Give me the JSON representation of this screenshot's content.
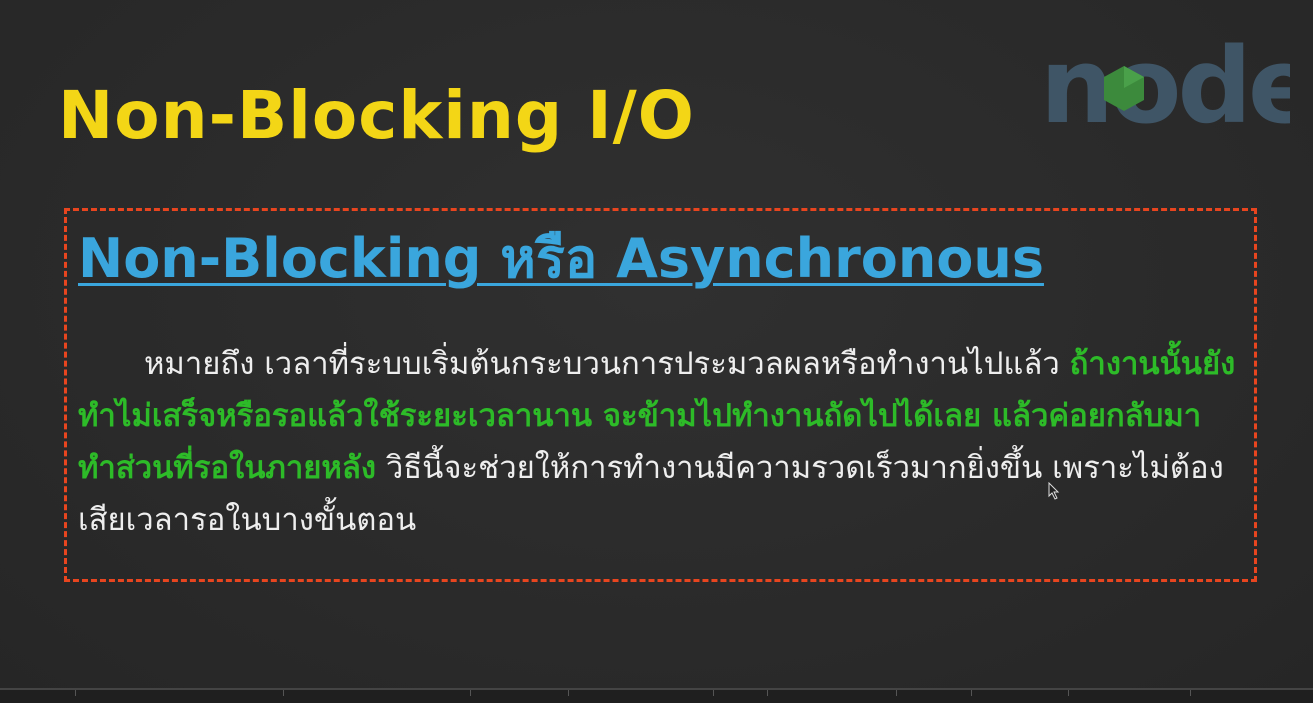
{
  "slide": {
    "title": "Non-Blocking I/O",
    "logo_text": "node",
    "subtitle": "Non-Blocking หรือ Asynchronous",
    "paragraph": {
      "line1": "หมายถึง เวลาที่ระบบเริ่มต้นกระบวนการประมวลผลหรือทำงานไปแล้ว",
      "highlight": "ถ้างานนั้นยังทำไม่เสร็จหรือรอแล้วใช้ระยะเวลานาน จะข้ามไปทำงานถัดไปได้เลย แล้วค่อยกลับมาทำส่วนที่รอในภายหลัง",
      "rest": "วิธีนี้จะช่วยให้การทำงานมีความรวดเร็วมากยิ่งขึ้น เพราะไม่ต้องเสียเวลารอในบางขั้นตอน"
    }
  },
  "colors": {
    "background": "#2a2a2a",
    "title": "#f3d616",
    "subtitle": "#3aa6dd",
    "highlight": "#2dbb28",
    "text": "#eeeeee",
    "border": "#e8451f",
    "logo_gray": "#3f5566",
    "logo_green": "#3c8a3c"
  },
  "icons": [
    "nodejs-logo-icon",
    "mouse-cursor-icon"
  ]
}
